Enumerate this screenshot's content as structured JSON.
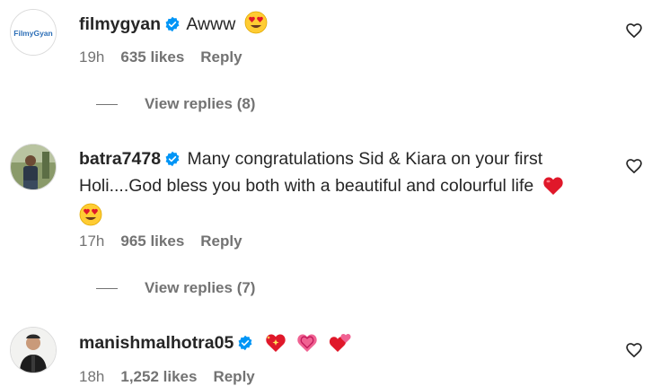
{
  "comments": [
    {
      "username": "filmygyan",
      "avatar_text": "FilmyGyan",
      "text": "Awww",
      "emoji": [
        "heart-eyes"
      ],
      "time": "19h",
      "likes": "635 likes",
      "reply": "Reply",
      "view_replies": "View replies (8)"
    },
    {
      "username": "batra7478",
      "text": "Many congratulations Sid & Kiara on your first Holi....God bless you both with a beautiful and colourful life",
      "emoji": [
        "red-heart",
        "heart-eyes"
      ],
      "time": "17h",
      "likes": "965 likes",
      "reply": "Reply",
      "view_replies": "View replies (7)"
    },
    {
      "username": "manishmalhotra05",
      "text": "",
      "emoji": [
        "sparkling-heart",
        "growing-heart",
        "revolving-hearts"
      ],
      "time": "18h",
      "likes": "1,252 likes",
      "reply": "Reply"
    }
  ],
  "colors": {
    "text": "#262626",
    "secondary": "#737373",
    "verified": "#0095f6",
    "heart_red": "#e0182a",
    "heart_pink": "#f06292"
  },
  "icons": [
    "verified-badge-icon",
    "like-heart-outline-icon",
    "heart-eyes-emoji",
    "red-heart-emoji"
  ]
}
